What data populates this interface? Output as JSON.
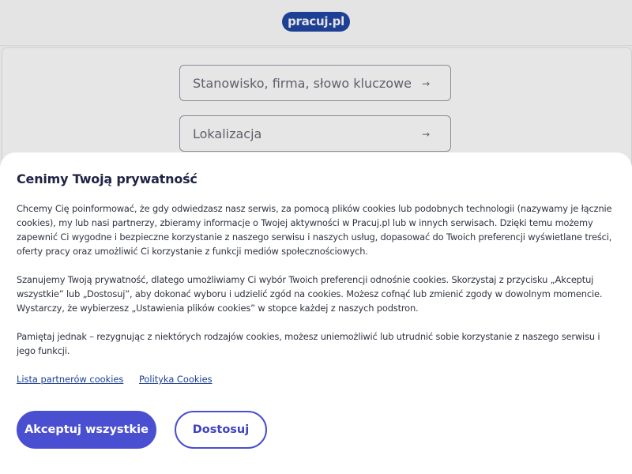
{
  "header": {
    "logo_text": "pracuj.pl"
  },
  "search": {
    "keyword_placeholder": "Stanowisko, firma, słowo kluczowe",
    "location_placeholder": "Lokalizacja",
    "arrow_glyph": "→"
  },
  "consent": {
    "title": "Cenimy Twoją prywatność",
    "paragraph_1": "Chcemy Cię poinformować, że gdy odwiedzasz nasz serwis, za pomocą plików cookies lub podobnych technologii (nazywamy je łącznie cookies), my lub nasi partnerzy, zbieramy informacje o Twojej aktywności w Pracuj.pl lub w innych serwisach. Dzięki temu możemy zapewnić Ci wygodne i bezpieczne korzystanie z naszego serwisu i naszych usług, dopasować do Twoich preferencji wyświetlane treści, oferty pracy oraz umożliwić Ci korzystanie z funkcji mediów społecznościowych.",
    "paragraph_2": "Szanujemy Twoją prywatność, dlatego umożliwiamy Ci wybór Twoich preferencji odnośnie cookies. Skorzystaj z przycisku „Akceptuj wszystkie” lub „Dostosuj”, aby dokonać wyboru i udzielić zgód na cookies. Możesz cofnąć lub zmienić zgody w dowolnym momencie. Wystarczy, że wybierzesz „Ustawienia plików cookies” w stopce każdej z naszych podstron.",
    "paragraph_3": "Pamiętaj jednak – rezygnując z niektórych rodzajów cookies, możesz uniemożliwić lub utrudnić sobie korzystanie z naszego serwisu i jego funkcji.",
    "link_partners": "Lista partnerów cookies",
    "link_policy": "Polityka Cookies",
    "accept_label": "Akceptuj wszystkie",
    "customize_label": "Dostosuj"
  },
  "colors": {
    "brand_navy": "#1d3f94",
    "accent_button": "#4a4fd1",
    "text_dark": "#1f2344"
  }
}
